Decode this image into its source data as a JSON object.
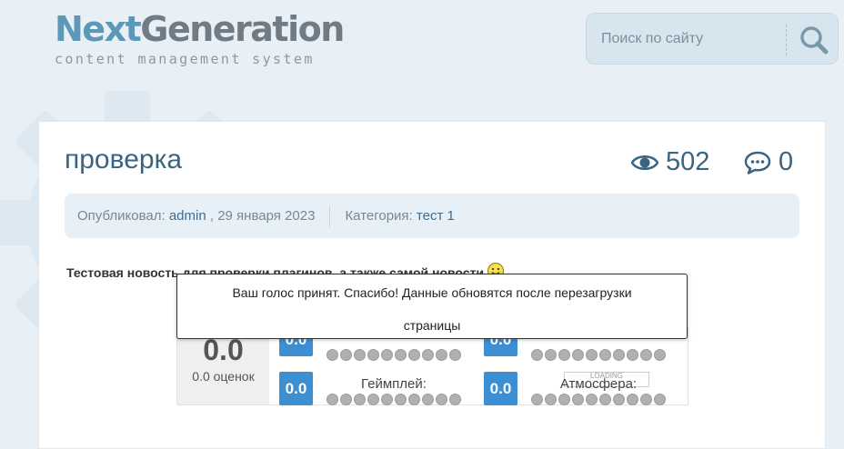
{
  "logo": {
    "part1": "Next",
    "part2": "Generation",
    "tagline": "content management system"
  },
  "search": {
    "placeholder": "Поиск по сайту"
  },
  "article": {
    "title": "проверка",
    "views": "502",
    "comments": "0",
    "meta": {
      "published_label": "Опубликовал:",
      "author": "admin",
      "date": ", 29 января 2023",
      "category_label": "Категория:",
      "category": "тест 1"
    },
    "lead": "Тестовая новость для проверки плагинов, а также самой новости"
  },
  "rating": {
    "total": "0.0",
    "votes": "0.0 оценок",
    "criteria": [
      {
        "score": "0.0",
        "label": "",
        "dots_filled": 0,
        "dots_total": 10
      },
      {
        "score": "0.0",
        "label": "",
        "dots_filled": 0,
        "dots_total": 10
      },
      {
        "score": "0.0",
        "label": "Геймплей:",
        "dots_filled": 0,
        "dots_total": 10
      },
      {
        "score": "0.0",
        "label": "Атмосфера:",
        "dots_filled": 0,
        "dots_total": 10
      }
    ],
    "loading_text": "LOADING"
  },
  "popup": {
    "message": "Ваш голос принят. Спасибо! Данные обновятся после перезагрузки страницы"
  },
  "colors": {
    "accent": "#3b6480",
    "badge": "#3d8fd4",
    "meta_bg": "#e7f0f6",
    "page_bg": "#e9f0f5"
  },
  "icons": [
    "eye-icon",
    "comment-icon",
    "search-icon",
    "smiley-icon",
    "gear-background"
  ]
}
